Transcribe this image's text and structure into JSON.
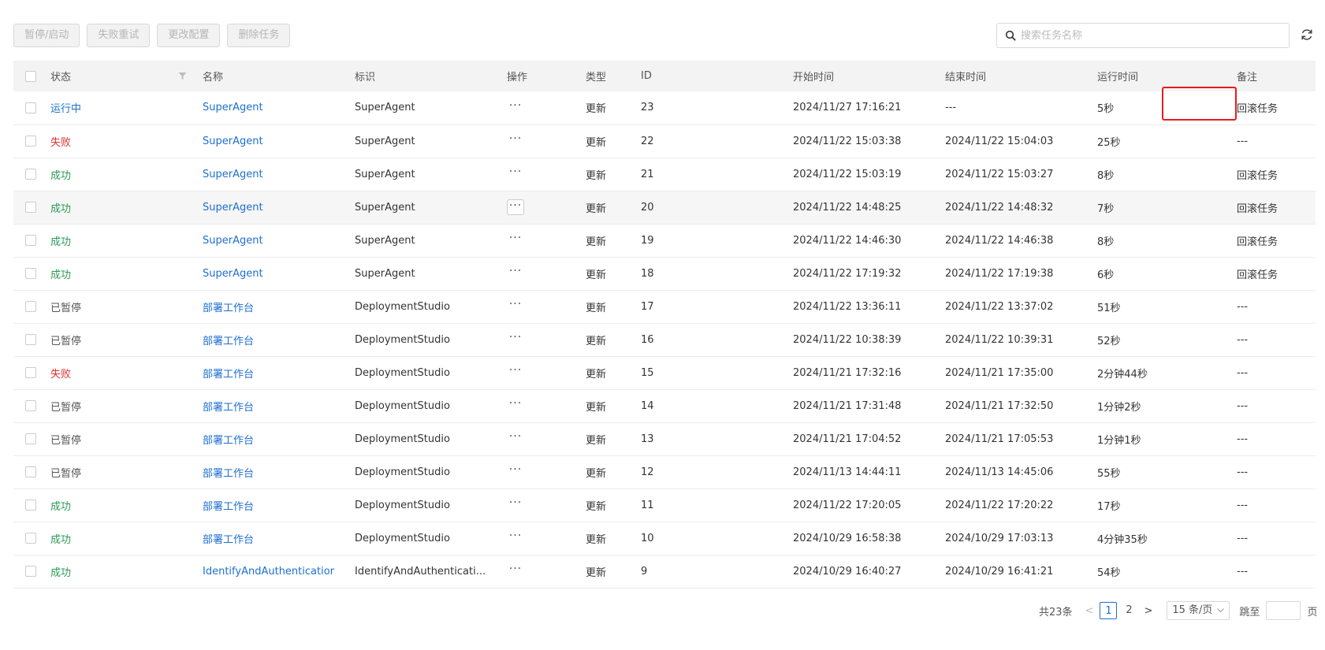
{
  "toolbar": {
    "pause_start": "暂停/启动",
    "retry_failed": "失败重试",
    "change_config": "更改配置",
    "delete_task": "删除任务"
  },
  "search": {
    "placeholder": "搜索任务名称",
    "icon": "search-icon"
  },
  "refresh_icon": "refresh-icon",
  "table": {
    "headers": {
      "status": "状态",
      "name": "名称",
      "identifier": "标识",
      "action": "操作",
      "type": "类型",
      "id": "ID",
      "start_time": "开始时间",
      "end_time": "结束时间",
      "run_time": "运行时间",
      "remark": "备注"
    },
    "rows": [
      {
        "status": "运行中",
        "status_kind": "running",
        "name": "SuperAgent",
        "identifier": "SuperAgent",
        "ops": "···",
        "type": "更新",
        "id": "23",
        "start": "2024/11/27 17:16:21",
        "end": "---",
        "duration": "5秒",
        "remark": "回滚任务"
      },
      {
        "status": "失败",
        "status_kind": "fail",
        "name": "SuperAgent",
        "identifier": "SuperAgent",
        "ops": "···",
        "type": "更新",
        "id": "22",
        "start": "2024/11/22 15:03:38",
        "end": "2024/11/22 15:04:03",
        "duration": "25秒",
        "remark": "---"
      },
      {
        "status": "成功",
        "status_kind": "ok",
        "name": "SuperAgent",
        "identifier": "SuperAgent",
        "ops": "···",
        "type": "更新",
        "id": "21",
        "start": "2024/11/22 15:03:19",
        "end": "2024/11/22 15:03:27",
        "duration": "8秒",
        "remark": "回滚任务"
      },
      {
        "status": "成功",
        "status_kind": "ok",
        "name": "SuperAgent",
        "identifier": "SuperAgent",
        "ops": "···",
        "type": "更新",
        "id": "20",
        "start": "2024/11/22 14:48:25",
        "end": "2024/11/22 14:48:32",
        "duration": "7秒",
        "remark": "回滚任务"
      },
      {
        "status": "成功",
        "status_kind": "ok",
        "name": "SuperAgent",
        "identifier": "SuperAgent",
        "ops": "···",
        "type": "更新",
        "id": "19",
        "start": "2024/11/22 14:46:30",
        "end": "2024/11/22 14:46:38",
        "duration": "8秒",
        "remark": "回滚任务"
      },
      {
        "status": "成功",
        "status_kind": "ok",
        "name": "SuperAgent",
        "identifier": "SuperAgent",
        "ops": "···",
        "type": "更新",
        "id": "18",
        "start": "2024/11/22 17:19:32",
        "end": "2024/11/22 17:19:38",
        "duration": "6秒",
        "remark": "回滚任务"
      },
      {
        "status": "已暂停",
        "status_kind": "paused",
        "name": "部署工作台",
        "identifier": "DeploymentStudio",
        "ops": "···",
        "type": "更新",
        "id": "17",
        "start": "2024/11/22 13:36:11",
        "end": "2024/11/22 13:37:02",
        "duration": "51秒",
        "remark": "---"
      },
      {
        "status": "已暂停",
        "status_kind": "paused",
        "name": "部署工作台",
        "identifier": "DeploymentStudio",
        "ops": "···",
        "type": "更新",
        "id": "16",
        "start": "2024/11/22 10:38:39",
        "end": "2024/11/22 10:39:31",
        "duration": "52秒",
        "remark": "---"
      },
      {
        "status": "失败",
        "status_kind": "fail",
        "name": "部署工作台",
        "identifier": "DeploymentStudio",
        "ops": "···",
        "type": "更新",
        "id": "15",
        "start": "2024/11/21 17:32:16",
        "end": "2024/11/21 17:35:00",
        "duration": "2分钟44秒",
        "remark": "---"
      },
      {
        "status": "已暂停",
        "status_kind": "paused",
        "name": "部署工作台",
        "identifier": "DeploymentStudio",
        "ops": "···",
        "type": "更新",
        "id": "14",
        "start": "2024/11/21 17:31:48",
        "end": "2024/11/21 17:32:50",
        "duration": "1分钟2秒",
        "remark": "---"
      },
      {
        "status": "已暂停",
        "status_kind": "paused",
        "name": "部署工作台",
        "identifier": "DeploymentStudio",
        "ops": "···",
        "type": "更新",
        "id": "13",
        "start": "2024/11/21 17:04:52",
        "end": "2024/11/21 17:05:53",
        "duration": "1分钟1秒",
        "remark": "---"
      },
      {
        "status": "已暂停",
        "status_kind": "paused",
        "name": "部署工作台",
        "identifier": "DeploymentStudio",
        "ops": "···",
        "type": "更新",
        "id": "12",
        "start": "2024/11/13 14:44:11",
        "end": "2024/11/13 14:45:06",
        "duration": "55秒",
        "remark": "---"
      },
      {
        "status": "成功",
        "status_kind": "ok",
        "name": "部署工作台",
        "identifier": "DeploymentStudio",
        "ops": "···",
        "type": "更新",
        "id": "11",
        "start": "2024/11/22 17:20:05",
        "end": "2024/11/22 17:20:22",
        "duration": "17秒",
        "remark": "---"
      },
      {
        "status": "成功",
        "status_kind": "ok",
        "name": "部署工作台",
        "identifier": "DeploymentStudio",
        "ops": "···",
        "type": "更新",
        "id": "10",
        "start": "2024/10/29 16:58:38",
        "end": "2024/10/29 17:03:13",
        "duration": "4分钟35秒",
        "remark": "---"
      },
      {
        "status": "成功",
        "status_kind": "ok",
        "name": "IdentifyAndAuthenticatior",
        "identifier": "IdentifyAndAuthenticati...",
        "ops": "···",
        "type": "更新",
        "id": "9",
        "start": "2024/10/29 16:40:27",
        "end": "2024/10/29 16:41:21",
        "duration": "54秒",
        "remark": "---"
      }
    ]
  },
  "pagination": {
    "total": "共23条",
    "pages": [
      "1",
      "2"
    ],
    "current": "1",
    "page_size": "15 条/页",
    "jump_label": "跳至",
    "page_suffix": "页"
  }
}
